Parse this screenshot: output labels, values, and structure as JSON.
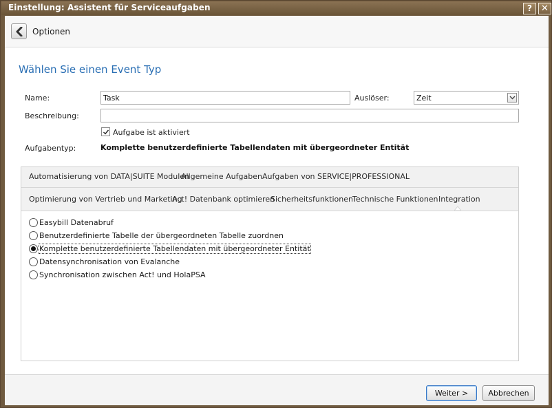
{
  "window": {
    "title": "Einstellung: Assistent für Serviceaufgaben",
    "help_label": "?",
    "close_label": "✕"
  },
  "nav": {
    "back_icon": "back-arrow-icon",
    "label": "Optionen"
  },
  "heading": "Wählen Sie einen Event Typ",
  "form": {
    "name_label": "Name:",
    "name_value": "Task",
    "trigger_label": "Auslöser:",
    "trigger_value": "Zeit",
    "description_label": "Beschreibung:",
    "description_value": "",
    "active_label": "Aufgabe ist aktiviert",
    "active_checked": true,
    "tasktype_label": "Aufgabentyp:",
    "tasktype_value": "Komplette benutzerdefinierte Tabellendaten mit übergeordneter Entität"
  },
  "tabs_row1": [
    "Automatisierung von DATA|SUITE Modulen",
    "Allgemeine Aufgaben",
    "Aufgaben von SERVICE|PROFESSIONAL"
  ],
  "tabs_row2": [
    "Optimierung von Vertrieb und Marketing",
    "Act! Datenbank optimieren",
    "Sicherheitsfunktionen",
    "Technische Funktionen",
    "Integration"
  ],
  "active_tab": "Integration",
  "options": [
    {
      "label": "Easybill Datenabruf",
      "selected": false
    },
    {
      "label": "Benutzerdefinierte Tabelle der übergeordneten Tabelle zuordnen",
      "selected": false
    },
    {
      "label": "Komplette benutzerdefinierte Tabellendaten mit übergeordneter Entität",
      "selected": true
    },
    {
      "label": "Datensynchronisation von Evalanche",
      "selected": false
    },
    {
      "label": "Synchronisation zwischen Act! und HolaPSA",
      "selected": false
    }
  ],
  "buttons": {
    "next": "Weiter >",
    "cancel": "Abbrechen"
  },
  "colors": {
    "titlebar": "#6f5a3f",
    "heading": "#2a6fb4",
    "primary_border": "#3a78c6"
  }
}
